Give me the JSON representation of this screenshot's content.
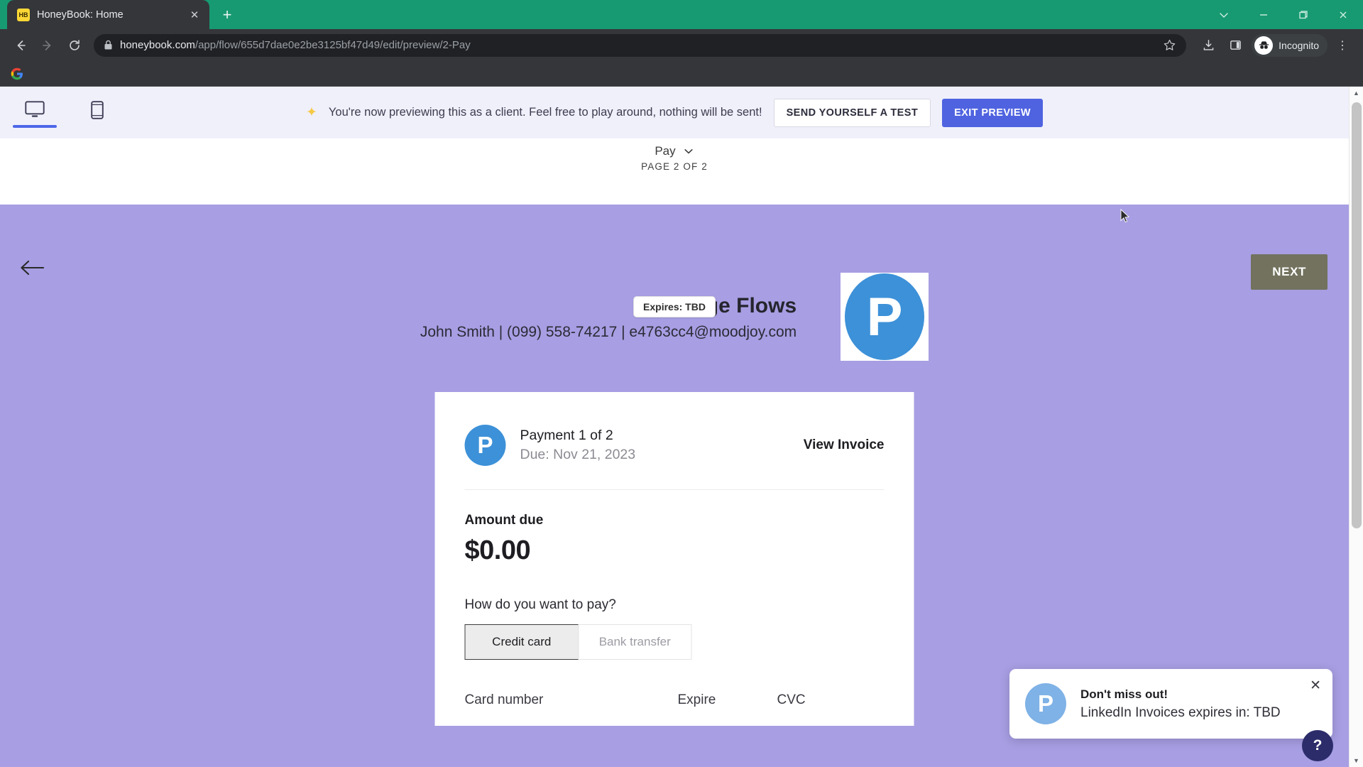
{
  "browser": {
    "tab": {
      "title": "HoneyBook: Home",
      "favicon_text": "HB",
      "favicon_name": "honeybook-favicon",
      "close_glyph": "✕"
    },
    "newtab_glyph": "+",
    "window_controls": [
      {
        "name": "chevron-down-icon",
        "glyph": "⌄"
      },
      {
        "name": "minimize-icon",
        "glyph": "—"
      },
      {
        "name": "restore-icon",
        "glyph": "❐"
      },
      {
        "name": "close-icon",
        "glyph": "✕"
      }
    ],
    "nav": {
      "back_glyph": "←",
      "forward_glyph": "→",
      "reload_glyph": "⟳"
    },
    "url_domain": "honeybook.com",
    "url_path": "/app/flow/655d7dae0e2be3125bf47d49/edit/preview/2-Pay",
    "url_full": "honeybook.com/app/flow/655d7dae0e2be3125bf47d49/edit/preview/2-Pay",
    "toolbar_icons": [
      {
        "name": "bookmark-star-icon",
        "glyph": "☆"
      },
      {
        "name": "download-icon",
        "glyph": "⤓"
      },
      {
        "name": "side-panel-icon",
        "glyph": "▯"
      }
    ],
    "profile_label": "Incognito",
    "menu_glyph": "⋮",
    "bookmarks": [
      {
        "name": "google-bookmark",
        "label": ""
      }
    ]
  },
  "preview_banner": {
    "sparkle_glyph": "✦",
    "message": "You're now previewing this as a client. Feel free to play around, nothing will be sent!",
    "send_test_label": "SEND YOURSELF A TEST",
    "exit_preview_label": "EXIT PREVIEW",
    "exit_preview_color": "#4f63e0",
    "devices": [
      {
        "name": "desktop-view-toggle",
        "active": true
      },
      {
        "name": "mobile-view-toggle",
        "active": false
      }
    ]
  },
  "page_header": {
    "back_glyph": "←",
    "section_label": "Pay",
    "chevron_glyph": "⌄",
    "page_indicator": "PAGE 2 OF 2",
    "expires_chip": "Expires: TBD",
    "next_label": "NEXT",
    "next_color": "#72725e"
  },
  "brand": {
    "title": "Page Flows",
    "contact": "John Smith | (099) 558-74217 | e4763cc4@moodjoy.com",
    "logo_letter": "P",
    "logo_color": "#3d91d8",
    "background_color": "#a79ee3"
  },
  "payment_card": {
    "avatar_letter": "P",
    "payment_title": "Payment 1 of 2",
    "due_text": "Due: Nov 21, 2023",
    "view_invoice_label": "View Invoice",
    "amount_label": "Amount due",
    "amount_value": "$0.00",
    "how_pay_label": "How do you want to pay?",
    "methods": [
      {
        "label": "Credit card",
        "selected": true
      },
      {
        "label": "Bank transfer",
        "selected": false
      }
    ],
    "fields": [
      {
        "label": "Card number"
      },
      {
        "label": "Expire"
      },
      {
        "label": "CVC"
      }
    ]
  },
  "toast": {
    "avatar_letter": "P",
    "title": "Don't miss out!",
    "message": "LinkedIn Invoices expires in: TBD",
    "close_glyph": "✕"
  },
  "help_button": {
    "glyph": "?"
  },
  "scrollbar": {
    "up_glyph": "▲",
    "down_glyph": "▼"
  }
}
